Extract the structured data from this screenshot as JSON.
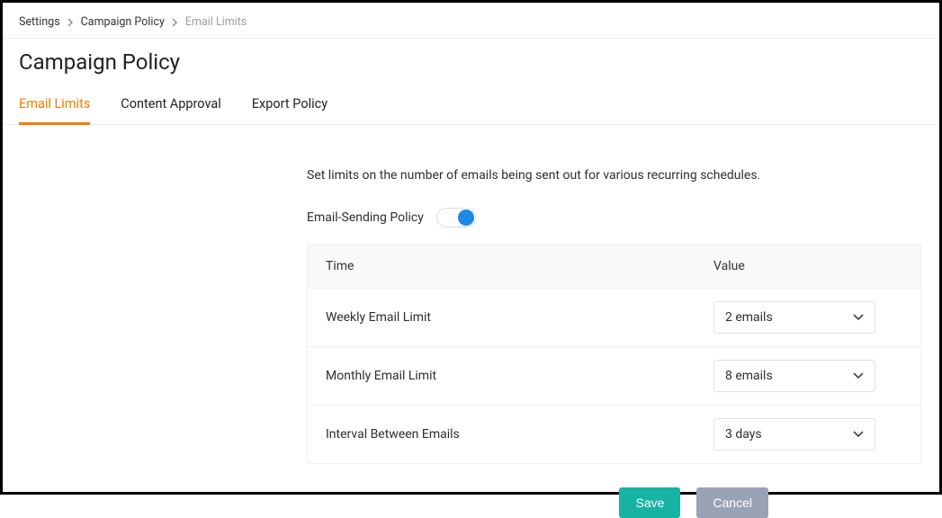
{
  "breadcrumb": {
    "items": [
      {
        "label": "Settings"
      },
      {
        "label": "Campaign Policy"
      },
      {
        "label": "Email Limits"
      }
    ]
  },
  "header": {
    "title": "Campaign Policy"
  },
  "tabs": [
    {
      "label": "Email Limits",
      "active": true
    },
    {
      "label": "Content Approval",
      "active": false
    },
    {
      "label": "Export Policy",
      "active": false
    }
  ],
  "main": {
    "description": "Set limits on the number of emails being sent out for various recurring schedules.",
    "policy_label": "Email-Sending Policy",
    "policy_enabled": true,
    "table": {
      "columns": {
        "time": "Time",
        "value": "Value"
      },
      "rows": [
        {
          "label": "Weekly Email Limit",
          "value": "2  emails"
        },
        {
          "label": "Monthly Email Limit",
          "value": "8 emails"
        },
        {
          "label": "Interval Between Emails",
          "value": "3 days"
        }
      ]
    }
  },
  "actions": {
    "save": "Save",
    "cancel": "Cancel"
  }
}
